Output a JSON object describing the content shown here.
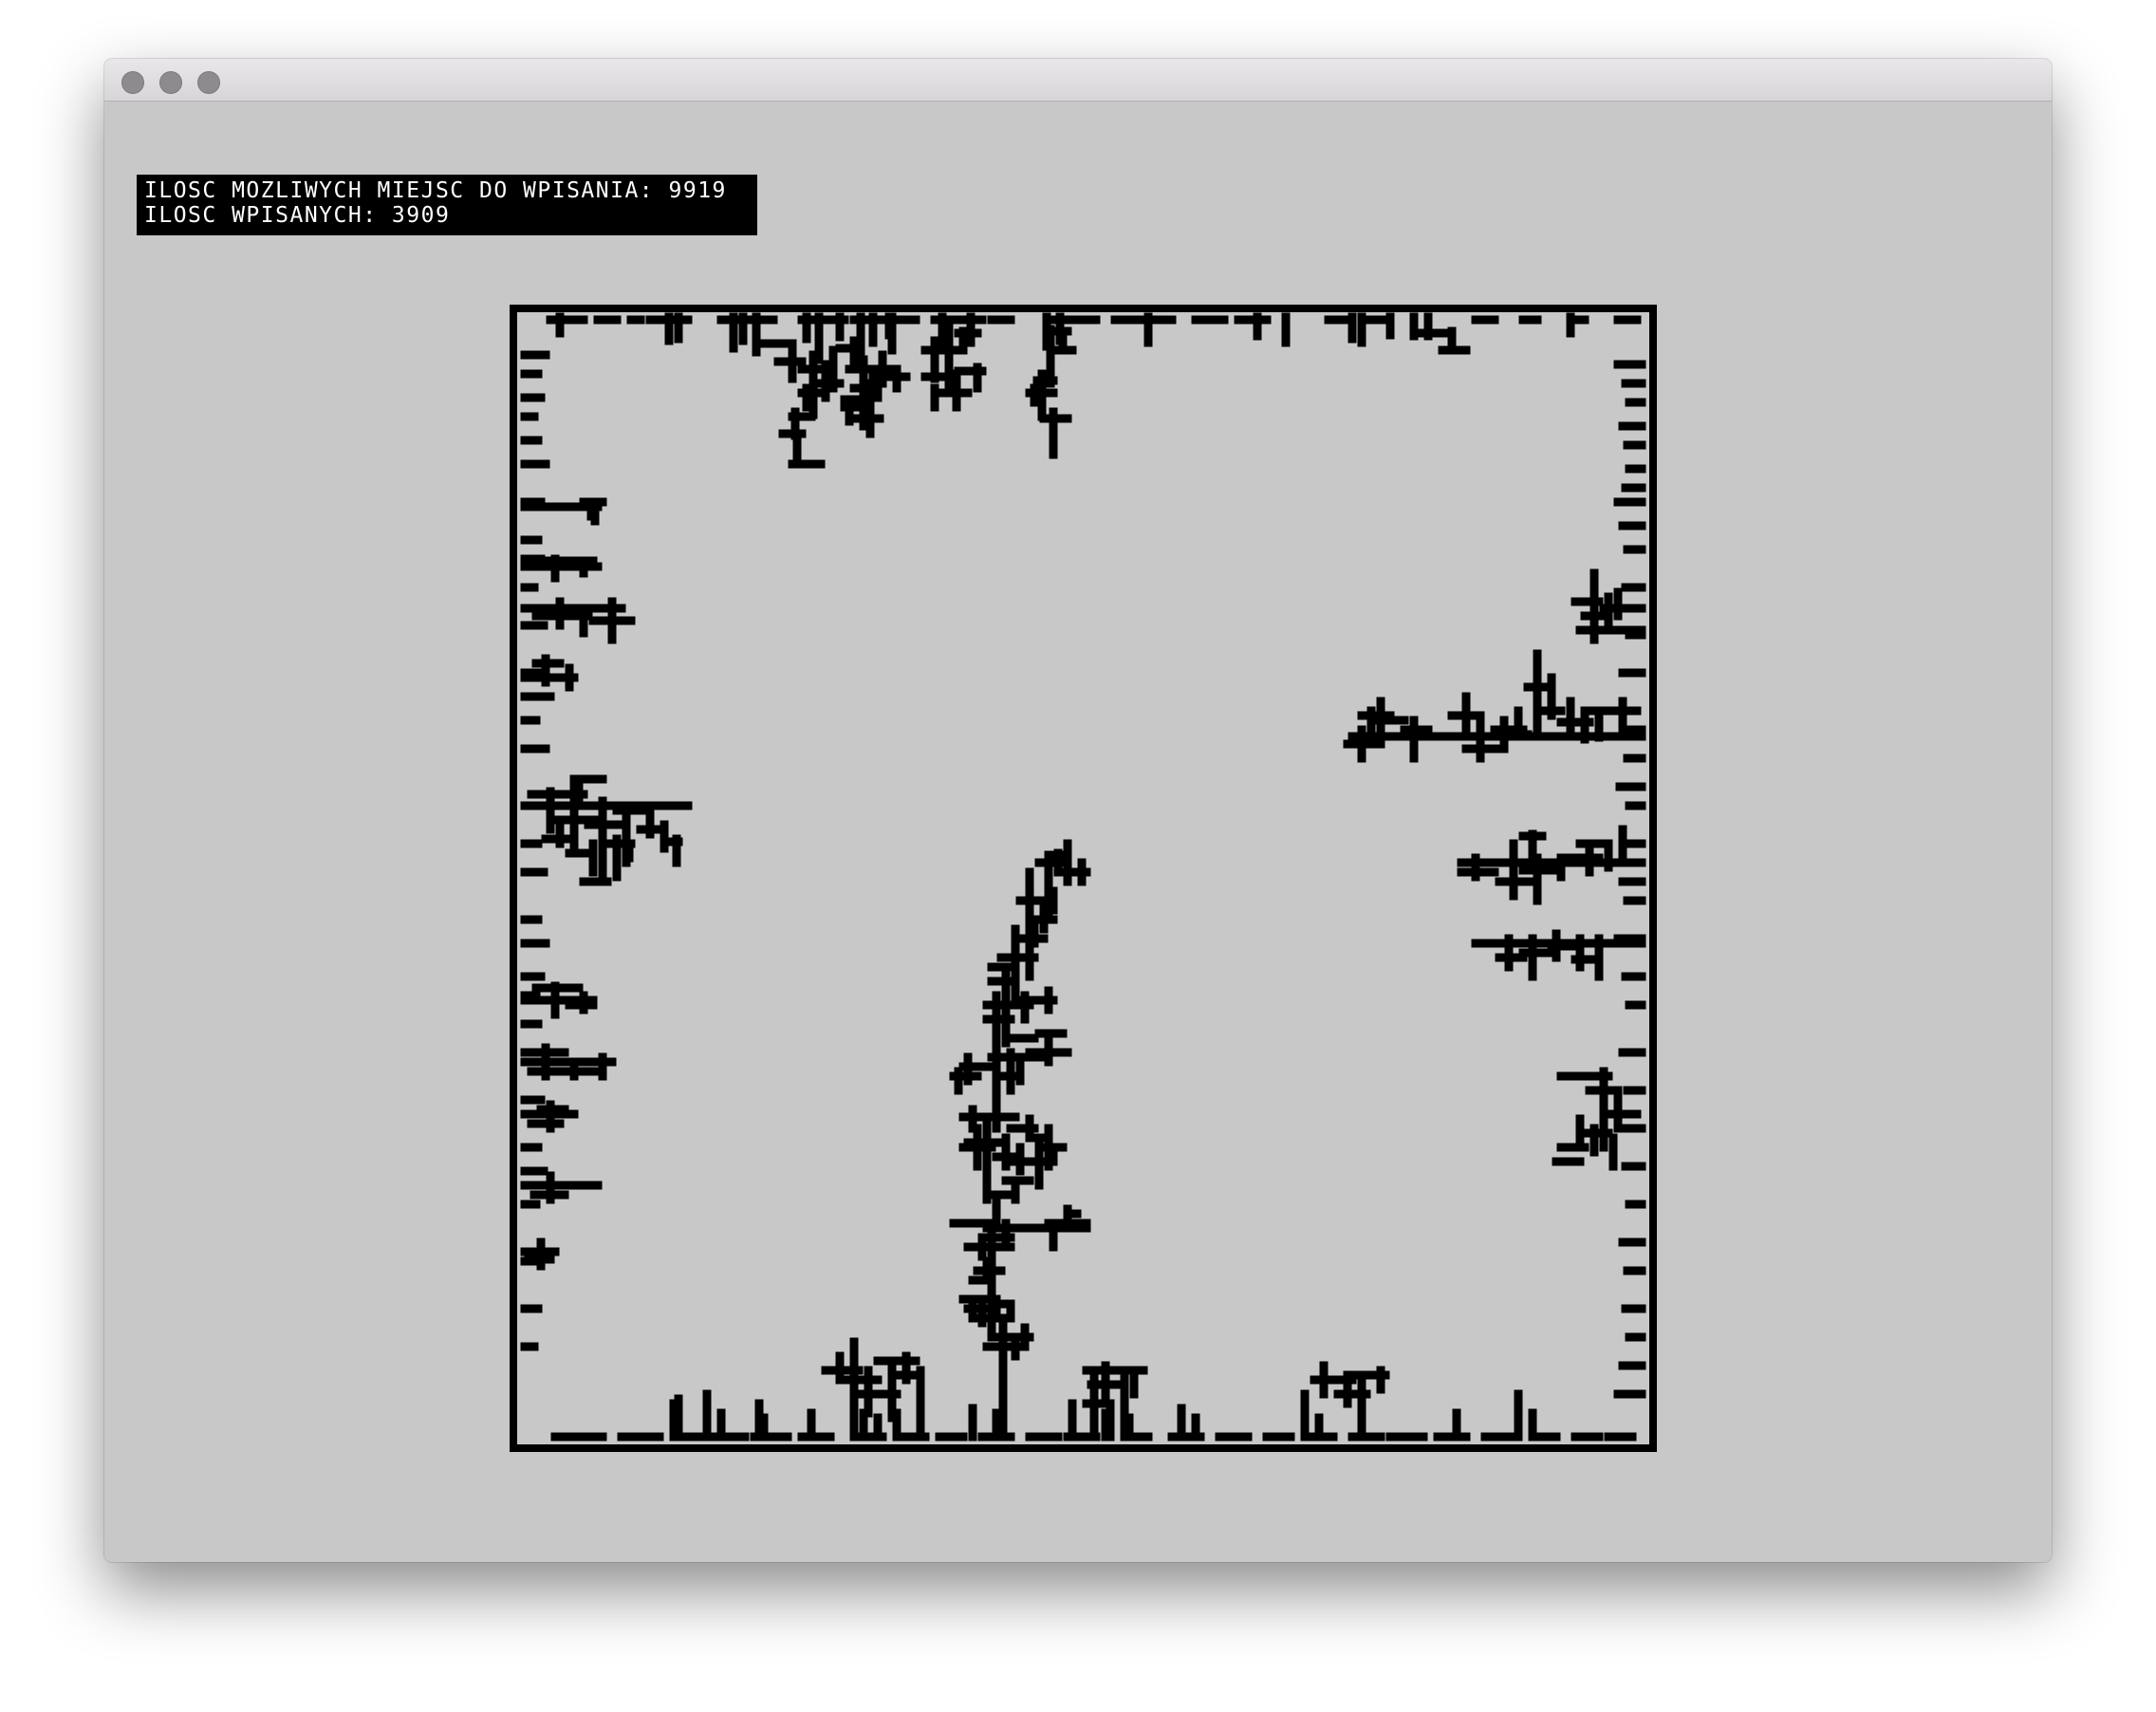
{
  "window": {
    "title": "",
    "controls": [
      "close-button",
      "minimize-button",
      "zoom-button"
    ]
  },
  "stats": {
    "line1_label": "ILOSC MOZLIWYCH MIEJSC DO WPISANIA:",
    "line1_value": "9919",
    "line2_label": "ILOSC WPISANYCH:",
    "line2_value": "3909"
  },
  "simulation": {
    "aggregate_color": "#000000",
    "background_color": "#c8c8c8",
    "border_color": "#000000"
  },
  "colors": {
    "window_bg": "#c8c8c8",
    "titlebar": "#dedcde",
    "traffic_light": "#8d8b8d",
    "stats_bg": "#000000",
    "stats_text": "#ffffff"
  }
}
